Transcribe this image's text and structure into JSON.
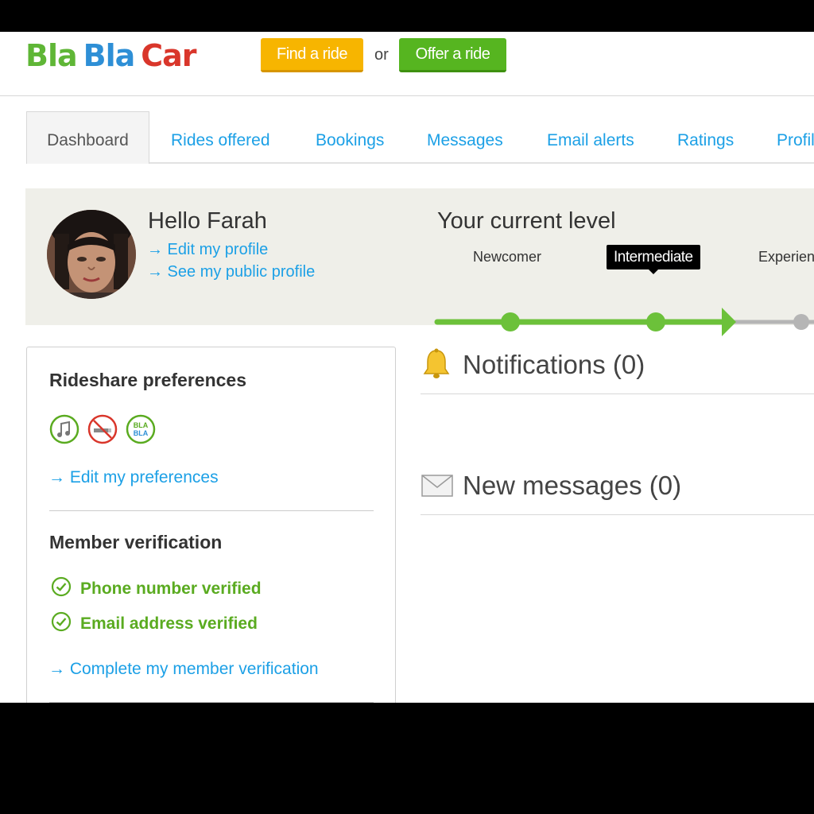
{
  "header": {
    "logo": {
      "part1": "Bla",
      "part2": "Bla",
      "part3": "Car"
    },
    "find_ride_label": "Find a ride",
    "or_label": "or",
    "offer_ride_label": "Offer a ride"
  },
  "tabs": [
    {
      "label": "Dashboard",
      "active": true
    },
    {
      "label": "Rides offered"
    },
    {
      "label": "Bookings"
    },
    {
      "label": "Messages"
    },
    {
      "label": "Email alerts"
    },
    {
      "label": "Ratings"
    },
    {
      "label": "Profil"
    }
  ],
  "profile": {
    "greeting": "Hello Farah",
    "edit_profile_link": "→ Edit my profile",
    "public_profile_link": "→ See my public profile"
  },
  "level": {
    "title": "Your current level",
    "levels": [
      "Newcomer",
      "Intermediate",
      "Experien"
    ],
    "current": "Intermediate"
  },
  "preferences": {
    "title": "Rideshare preferences",
    "icons": [
      "music-icon",
      "no-smoking-icon",
      "blabla-chat-icon"
    ],
    "blabla_badge": "BLA",
    "edit_link": "→ Edit my preferences"
  },
  "verification": {
    "title": "Member verification",
    "items": [
      "Phone number verified",
      "Email address verified"
    ],
    "complete_link": "→ Complete my member verification"
  },
  "notifications": {
    "title": "Notifications (0)"
  },
  "messages": {
    "title": "New messages (0)"
  },
  "colors": {
    "link": "#1ca0e6",
    "find_button": "#f7b500",
    "offer_button": "#56b520",
    "verified_green": "#5aab20",
    "progress_green": "#6cc13a",
    "progress_gray": "#b5b5b5"
  }
}
